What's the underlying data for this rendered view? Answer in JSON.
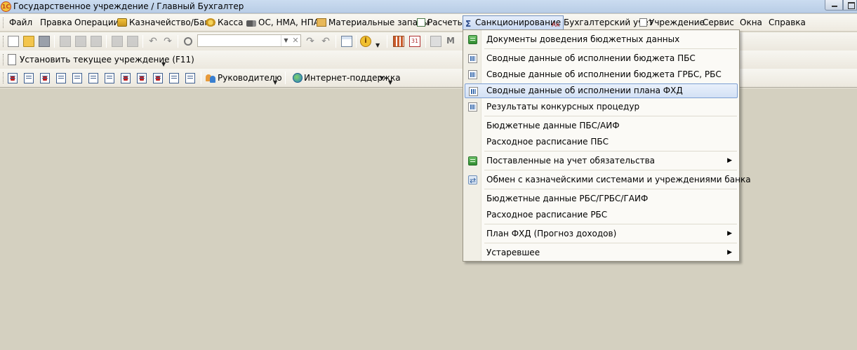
{
  "window": {
    "title": "Государственное учреждение / Главный Бухгалтер",
    "logo_text": "1С"
  },
  "menubar": [
    {
      "id": "file",
      "label": "Файл"
    },
    {
      "id": "edit",
      "label": "Правка"
    },
    {
      "id": "operations",
      "label": "Операции"
    },
    {
      "id": "treasury",
      "label": "Казначейство/Банк",
      "icon": "bank-icon"
    },
    {
      "id": "cash",
      "label": "Касса",
      "icon": "cash-icon"
    },
    {
      "id": "assets",
      "label": "ОС, НМА, НПА",
      "icon": "truck-icon"
    },
    {
      "id": "materials",
      "label": "Материальные запасы",
      "icon": "boxes-icon"
    },
    {
      "id": "settlements",
      "label": "Расчеты",
      "icon": "settlements-icon"
    },
    {
      "id": "sanction",
      "label": "Санкционирование",
      "icon": "sigma-icon",
      "active": true
    },
    {
      "id": "accounting",
      "label": "Бухгалтерский учет",
      "icon": "accounting-icon"
    },
    {
      "id": "institution",
      "label": "Учреждение",
      "icon": "institution-icon"
    },
    {
      "id": "service",
      "label": "Сервис"
    },
    {
      "id": "windows",
      "label": "Окна"
    },
    {
      "id": "help",
      "label": "Справка"
    }
  ],
  "toolbar": {
    "search_value": "",
    "set_institution_label": "Установить текущее учреждение (F11)",
    "manager_label": "Руководителю",
    "internet_support_label": "Интернет-поддержка",
    "overflow_label": "M"
  },
  "dropdown": {
    "items": [
      {
        "label": "Документы доведения бюджетных данных",
        "icon": "green",
        "submenu": false
      },
      {
        "label": "Сводные данные об исполнении бюджета ПБС",
        "icon": "chart",
        "submenu": false
      },
      {
        "label": "Сводные данные об исполнении бюджета ГРБС, РБС",
        "icon": "chart",
        "submenu": false
      },
      {
        "label": "Сводные данные об исполнении плана ФХД",
        "icon": "chart",
        "submenu": false,
        "highlighted": true
      },
      {
        "label": "Результаты конкурсных процедур",
        "icon": "chart",
        "submenu": false
      },
      {
        "label": "Бюджетные данные ПБС/АИФ",
        "icon": "",
        "submenu": false
      },
      {
        "label": "Расходное расписание ПБС",
        "icon": "",
        "submenu": false
      },
      {
        "label": "Поставленные на учет обязательства",
        "icon": "green",
        "submenu": true
      },
      {
        "label": "Обмен с казначейскими системами и учреждениями банка",
        "icon": "exch",
        "submenu": false
      },
      {
        "label": "Бюджетные данные РБС/ГРБС/ГАИФ",
        "icon": "",
        "submenu": false
      },
      {
        "label": "Расходное расписание РБС",
        "icon": "",
        "submenu": false
      },
      {
        "label": "План ФХД (Прогноз доходов)",
        "icon": "",
        "submenu": true
      },
      {
        "label": "Устаревшее",
        "icon": "",
        "submenu": true
      }
    ]
  },
  "colors": {
    "workspace": "#d4d0c0",
    "highlight_border": "#7c9fd3",
    "menu_background": "#fbfaf6"
  }
}
